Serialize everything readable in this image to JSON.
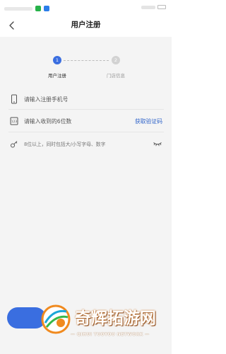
{
  "header": {
    "title": "用户注册"
  },
  "steps": [
    {
      "number": "1",
      "label": "用户注册",
      "active": true
    },
    {
      "number": "2",
      "label": "门店信息",
      "active": false
    }
  ],
  "form": {
    "phone": {
      "value": "",
      "placeholder": "请输入注册手机号"
    },
    "code": {
      "value": "",
      "placeholder": "请输入收到的6位数",
      "action_label": "获取验证码"
    },
    "password": {
      "value": "",
      "placeholder": "8位以上，同时包括大/小写字母、数字"
    }
  },
  "watermark": {
    "title": "奇辉拓游网",
    "subtitle": "— QIHUI TUOYOU NETWORK —"
  },
  "colors": {
    "accent": "#3a6ee0",
    "link": "#2f63c9",
    "inactive": "#d2d2d2",
    "background": "#f4f4f4"
  },
  "icons": {
    "back": "chevron-left-icon",
    "phone": "phone-icon",
    "code": "sms-code-icon",
    "password": "key-icon",
    "visibility": "eye-closed-icon"
  }
}
